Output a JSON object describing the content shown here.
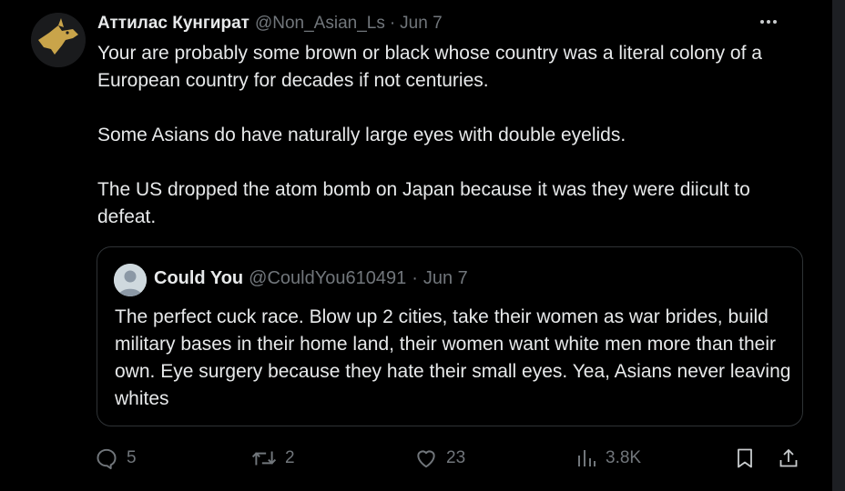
{
  "tweet": {
    "display_name": "Аттилас Кунгират",
    "handle": "@Non_Asian_Ls",
    "separator": "·",
    "date": "Jun 7",
    "paragraphs": [
      "Your are probably some brown or black whose country was a literal colony of a European country for decades if not centuries.",
      "Some Asians do have naturally large eyes with double eyelids.",
      "The US dropped the atom bomb on Japan because it was they were diicult to defeat."
    ]
  },
  "quote": {
    "display_name": "Could You",
    "handle": "@CouldYou610491",
    "separator": "·",
    "date": "Jun 7",
    "text": "The perfect cuck race. Blow up 2 cities, take their women as war brides, build military bases in their home land, their women want white men more than their own. Eye surgery because they hate their small eyes. Yea, Asians never leaving whites"
  },
  "actions": {
    "replies": "5",
    "reposts": "2",
    "likes": "23",
    "views": "3.8K"
  },
  "icons": {
    "more": "more-icon",
    "reply": "reply-icon",
    "repost": "repost-icon",
    "like": "like-icon",
    "views": "views-icon",
    "bookmark": "bookmark-icon",
    "share": "share-icon"
  },
  "colors": {
    "background": "#000000",
    "text": "#e7e9ea",
    "secondary": "#71767b",
    "border": "#2f3336",
    "avatar_gold": "#c9a44a"
  }
}
